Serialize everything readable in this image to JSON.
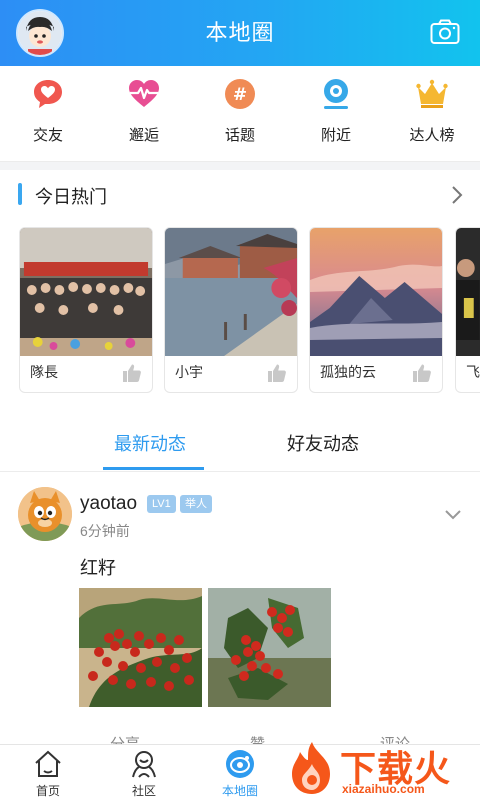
{
  "header": {
    "title": "本地圈",
    "avatar_icon": "cartoon-avatar",
    "camera_icon": "camera-icon"
  },
  "categories": [
    {
      "label": "交友",
      "icon": "heart-chat-icon",
      "color": "#f0574f"
    },
    {
      "label": "邂逅",
      "icon": "heartbeat-icon",
      "color": "#e84e93"
    },
    {
      "label": "话题",
      "icon": "hashtag-icon",
      "color": "#f08b55"
    },
    {
      "label": "附近",
      "icon": "location-icon",
      "color": "#36a8e8"
    },
    {
      "label": "达人榜",
      "icon": "crown-icon",
      "color": "#f5b731"
    }
  ],
  "hot": {
    "title": "今日热门",
    "cards": [
      {
        "name": "隊長"
      },
      {
        "name": "小宇"
      },
      {
        "name": "孤独的云"
      },
      {
        "name": "飞"
      }
    ]
  },
  "tabs": [
    {
      "label": "最新动态",
      "active": true
    },
    {
      "label": "好友动态",
      "active": false
    }
  ],
  "post": {
    "username": "yaotao",
    "level": "LV1",
    "tag": "举人",
    "time": "6分钟前",
    "text": "红籽",
    "actions": [
      "分享",
      "赞",
      "评论"
    ]
  },
  "bottom_nav": [
    {
      "label": "首页",
      "icon": "home-icon",
      "active": false
    },
    {
      "label": "社区",
      "icon": "community-icon",
      "active": false
    },
    {
      "label": "本地圈",
      "icon": "local-circle-icon",
      "active": true
    }
  ],
  "watermark": {
    "big": "下载火",
    "small": "xiazaihuo.com"
  },
  "colors": {
    "accent": "#2e9bef",
    "header_start": "#2d8ef5",
    "header_end": "#12c3ee"
  }
}
